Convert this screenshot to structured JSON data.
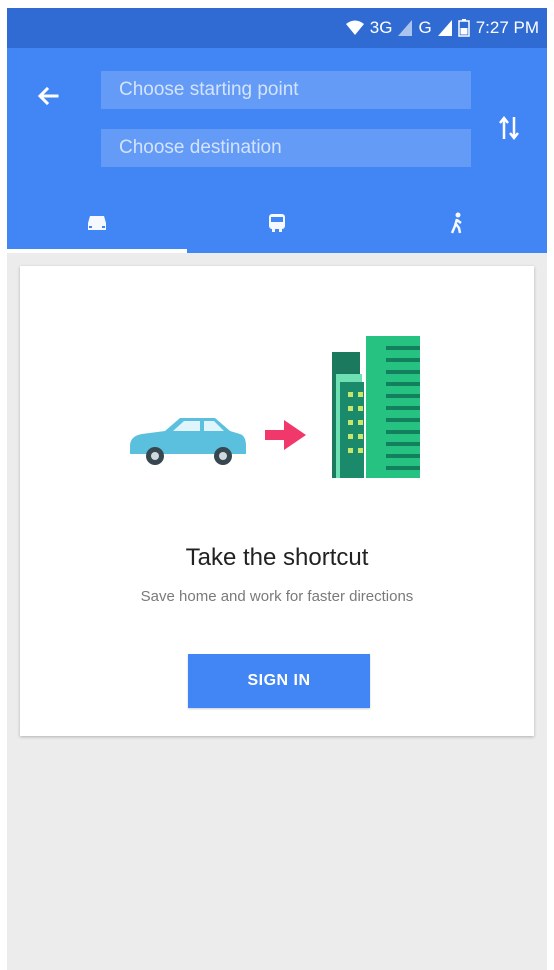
{
  "status_bar": {
    "network_label": "3G",
    "network_label_2": "G",
    "time": "7:27 PM"
  },
  "header": {
    "start_placeholder": "Choose starting point",
    "destination_placeholder": "Choose destination",
    "tabs": [
      {
        "icon": "car-icon",
        "selected": true
      },
      {
        "icon": "transit-icon",
        "selected": false
      },
      {
        "icon": "walk-icon",
        "selected": false
      }
    ]
  },
  "card": {
    "title": "Take the shortcut",
    "subtitle": "Save home and work for faster directions",
    "button_label": "SIGN IN"
  },
  "colors": {
    "status_bar": "#2f6bd3",
    "primary": "#4285f4",
    "background": "#ececec",
    "car": "#5bc0de",
    "arrow": "#f0386b",
    "building_dark": "#1b8a6b",
    "building_light": "#26c281"
  }
}
